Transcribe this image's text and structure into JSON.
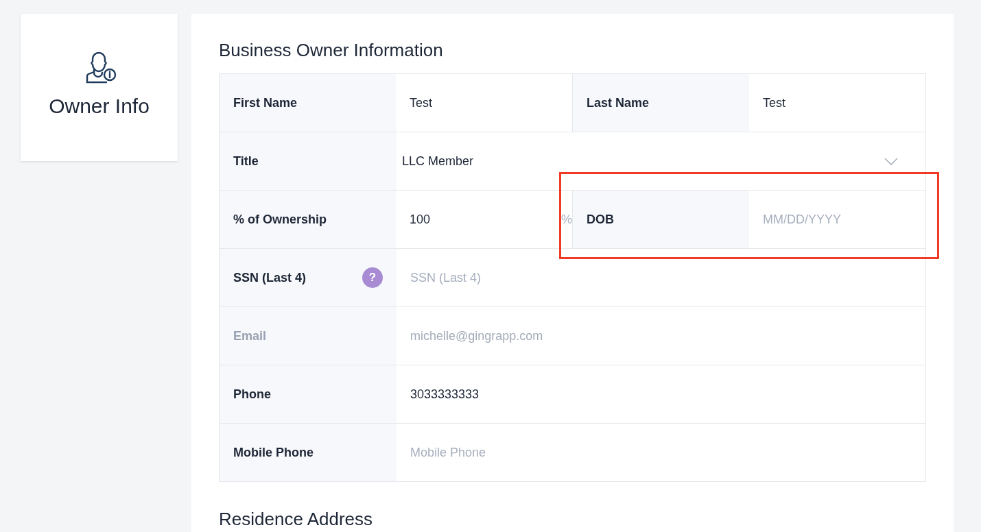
{
  "side_card": {
    "label": "Owner Info"
  },
  "section_title": "Business Owner Information",
  "rows": [
    {
      "kind": "pair",
      "fields": [
        {
          "label": "First Name",
          "value": "Test"
        },
        {
          "label": "Last Name",
          "value": "Test"
        }
      ]
    },
    {
      "kind": "select",
      "label": "Title",
      "value": "LLC Member"
    },
    {
      "kind": "pair",
      "fields": [
        {
          "label": "% of Ownership",
          "value": "100",
          "suffix": "%"
        },
        {
          "label": "DOB",
          "placeholder": "MM/DD/YYYY",
          "highlighted": true
        }
      ]
    },
    {
      "kind": "text",
      "label": "SSN (Last 4)",
      "help": "?",
      "placeholder": "SSN (Last 4)",
      "disabled": false
    },
    {
      "kind": "text",
      "label": "Email",
      "value": "michelle@gingrapp.com",
      "disabled": true
    },
    {
      "kind": "text",
      "label": "Phone",
      "value": "3033333333",
      "disabled": false
    },
    {
      "kind": "text",
      "label": "Mobile Phone",
      "placeholder": "Mobile Phone",
      "disabled": false
    }
  ],
  "next_section_title": "Residence Address"
}
